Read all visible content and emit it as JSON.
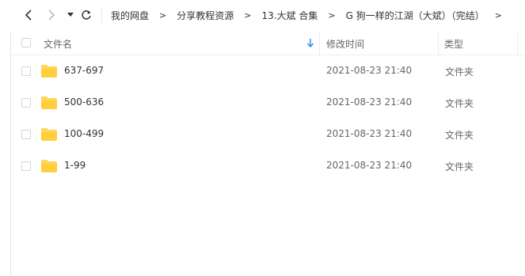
{
  "toolbar": {
    "breadcrumb": [
      "我的网盘",
      "分享教程资源",
      "13.大斌 合集",
      "G 狗一样的江湖（大斌）（完结）"
    ]
  },
  "header": {
    "name_label": "文件名",
    "modified_label": "修改时间",
    "type_label": "类型"
  },
  "files": [
    {
      "name": "637-697",
      "modified": "2021-08-23 21:40",
      "type": "文件夹"
    },
    {
      "name": "500-636",
      "modified": "2021-08-23 21:40",
      "type": "文件夹"
    },
    {
      "name": "100-499",
      "modified": "2021-08-23 21:40",
      "type": "文件夹"
    },
    {
      "name": "1-99",
      "modified": "2021-08-23 21:40",
      "type": "文件夹"
    }
  ],
  "colors": {
    "folder": "#ffd659",
    "sort_arrow": "#1a8cf0"
  },
  "icons": [
    "back-icon",
    "forward-icon",
    "dropdown-icon",
    "refresh-icon",
    "chevron-right-icon",
    "folder-icon",
    "sort-down-icon"
  ]
}
